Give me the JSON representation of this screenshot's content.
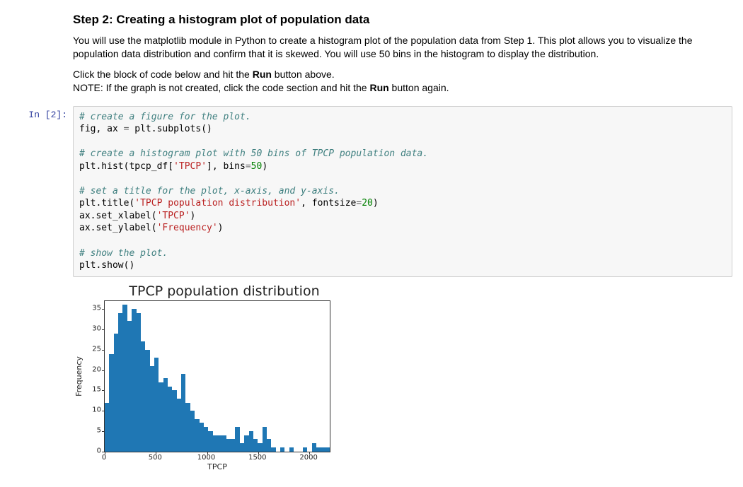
{
  "markdown": {
    "heading": "Step 2: Creating a histogram plot of population data",
    "p1": "You will use the matplotlib module in Python to create a histogram plot of the population data from Step 1. This plot allows you to visualize the population data distribution and confirm that it is skewed. You will use 50 bins in the histogram to display the distribution.",
    "p2_a": "Click the block of code below and hit the ",
    "p2_b": "Run",
    "p2_c": " button above.",
    "p3_a": "NOTE: If the graph is not created, click the code section and hit the ",
    "p3_b": "Run",
    "p3_c": " button again."
  },
  "prompt": "In [2]:",
  "code": {
    "c1": "# create a figure for the plot.",
    "l1a": "fig, ax ",
    "l1eq": "=",
    "l1b": " plt.subplots()",
    "c2": "# create a histogram plot with 50 bins of TPCP population data.",
    "l2a": "plt.hist(tpcp_df[",
    "l2s": "'TPCP'",
    "l2b": "], bins",
    "l2eq": "=",
    "l2n": "50",
    "l2c": ")",
    "c3": "# set a title for the plot, x-axis, and y-axis.",
    "l3a": "plt.title(",
    "l3s": "'TPCP population distribution'",
    "l3b": ", fontsize",
    "l3eq": "=",
    "l3n": "20",
    "l3c": ")",
    "l4a": "ax.set_xlabel(",
    "l4s": "'TPCP'",
    "l4b": ")",
    "l5a": "ax.set_ylabel(",
    "l5s": "'Frequency'",
    "l5b": ")",
    "c4": "# show the plot.",
    "l6": "plt.show()"
  },
  "chart_data": {
    "type": "bar",
    "title": "TPCP population distribution",
    "xlabel": "TPCP",
    "ylabel": "Frequency",
    "xlim": [
      0,
      2200
    ],
    "ylim": [
      0,
      37
    ],
    "xticks": [
      0,
      500,
      1000,
      1500,
      2000
    ],
    "yticks": [
      0,
      5,
      10,
      15,
      20,
      25,
      30,
      35
    ],
    "categories": [
      22,
      66,
      110,
      154,
      198,
      242,
      286,
      330,
      374,
      418,
      462,
      506,
      550,
      594,
      638,
      682,
      726,
      770,
      814,
      858,
      902,
      946,
      990,
      1034,
      1078,
      1122,
      1166,
      1210,
      1254,
      1298,
      1342,
      1386,
      1430,
      1474,
      1518,
      1562,
      1606,
      1650,
      1694,
      1738,
      1782,
      1826,
      1870,
      1914,
      1958,
      2002,
      2046,
      2090,
      2134,
      2178
    ],
    "values": [
      12,
      24,
      29,
      34,
      36,
      32,
      35,
      34,
      27,
      25,
      21,
      23,
      17,
      18,
      16,
      15,
      13,
      19,
      12,
      10,
      8,
      7,
      6,
      5,
      4,
      4,
      4,
      3,
      3,
      6,
      2,
      4,
      5,
      3,
      2,
      6,
      3,
      1,
      0,
      1,
      0,
      1,
      0,
      0,
      1,
      0,
      2,
      1,
      1,
      1
    ]
  }
}
